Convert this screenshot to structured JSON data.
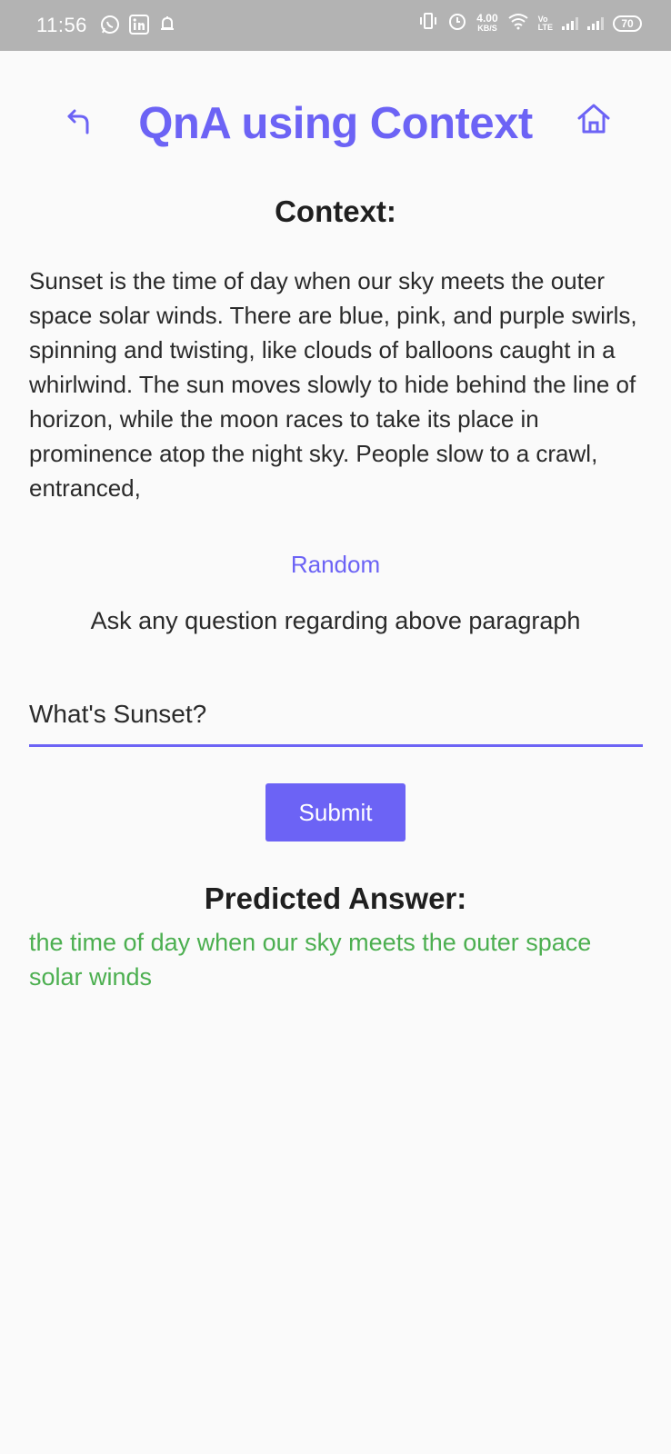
{
  "status_bar": {
    "time": "11:56",
    "speed_value": "4.00",
    "speed_unit": "KB/S",
    "volte_top": "Vo",
    "volte_bottom": "LTE",
    "battery": "70"
  },
  "header": {
    "title": "QnA using Context"
  },
  "context": {
    "heading": "Context:",
    "body": "Sunset is the time of day when our sky meets the outer space solar winds. There are blue, pink, and purple swirls, spinning and twisting, like clouds of balloons caught in a whirlwind. The sun moves slowly to hide behind the line of horizon, while the moon races to take its place in prominence atop the night sky. People slow to a crawl, entranced,"
  },
  "random_label": "Random",
  "question": {
    "prompt": "Ask any question regarding above paragraph",
    "value": "What's Sunset?"
  },
  "submit_label": "Submit",
  "answer": {
    "heading": "Predicted Answer:",
    "text": "the time of day when our sky meets the outer space solar winds"
  },
  "colors": {
    "accent": "#6c63f5",
    "answer": "#4caf50",
    "status_bar": "#b3b3b3"
  }
}
